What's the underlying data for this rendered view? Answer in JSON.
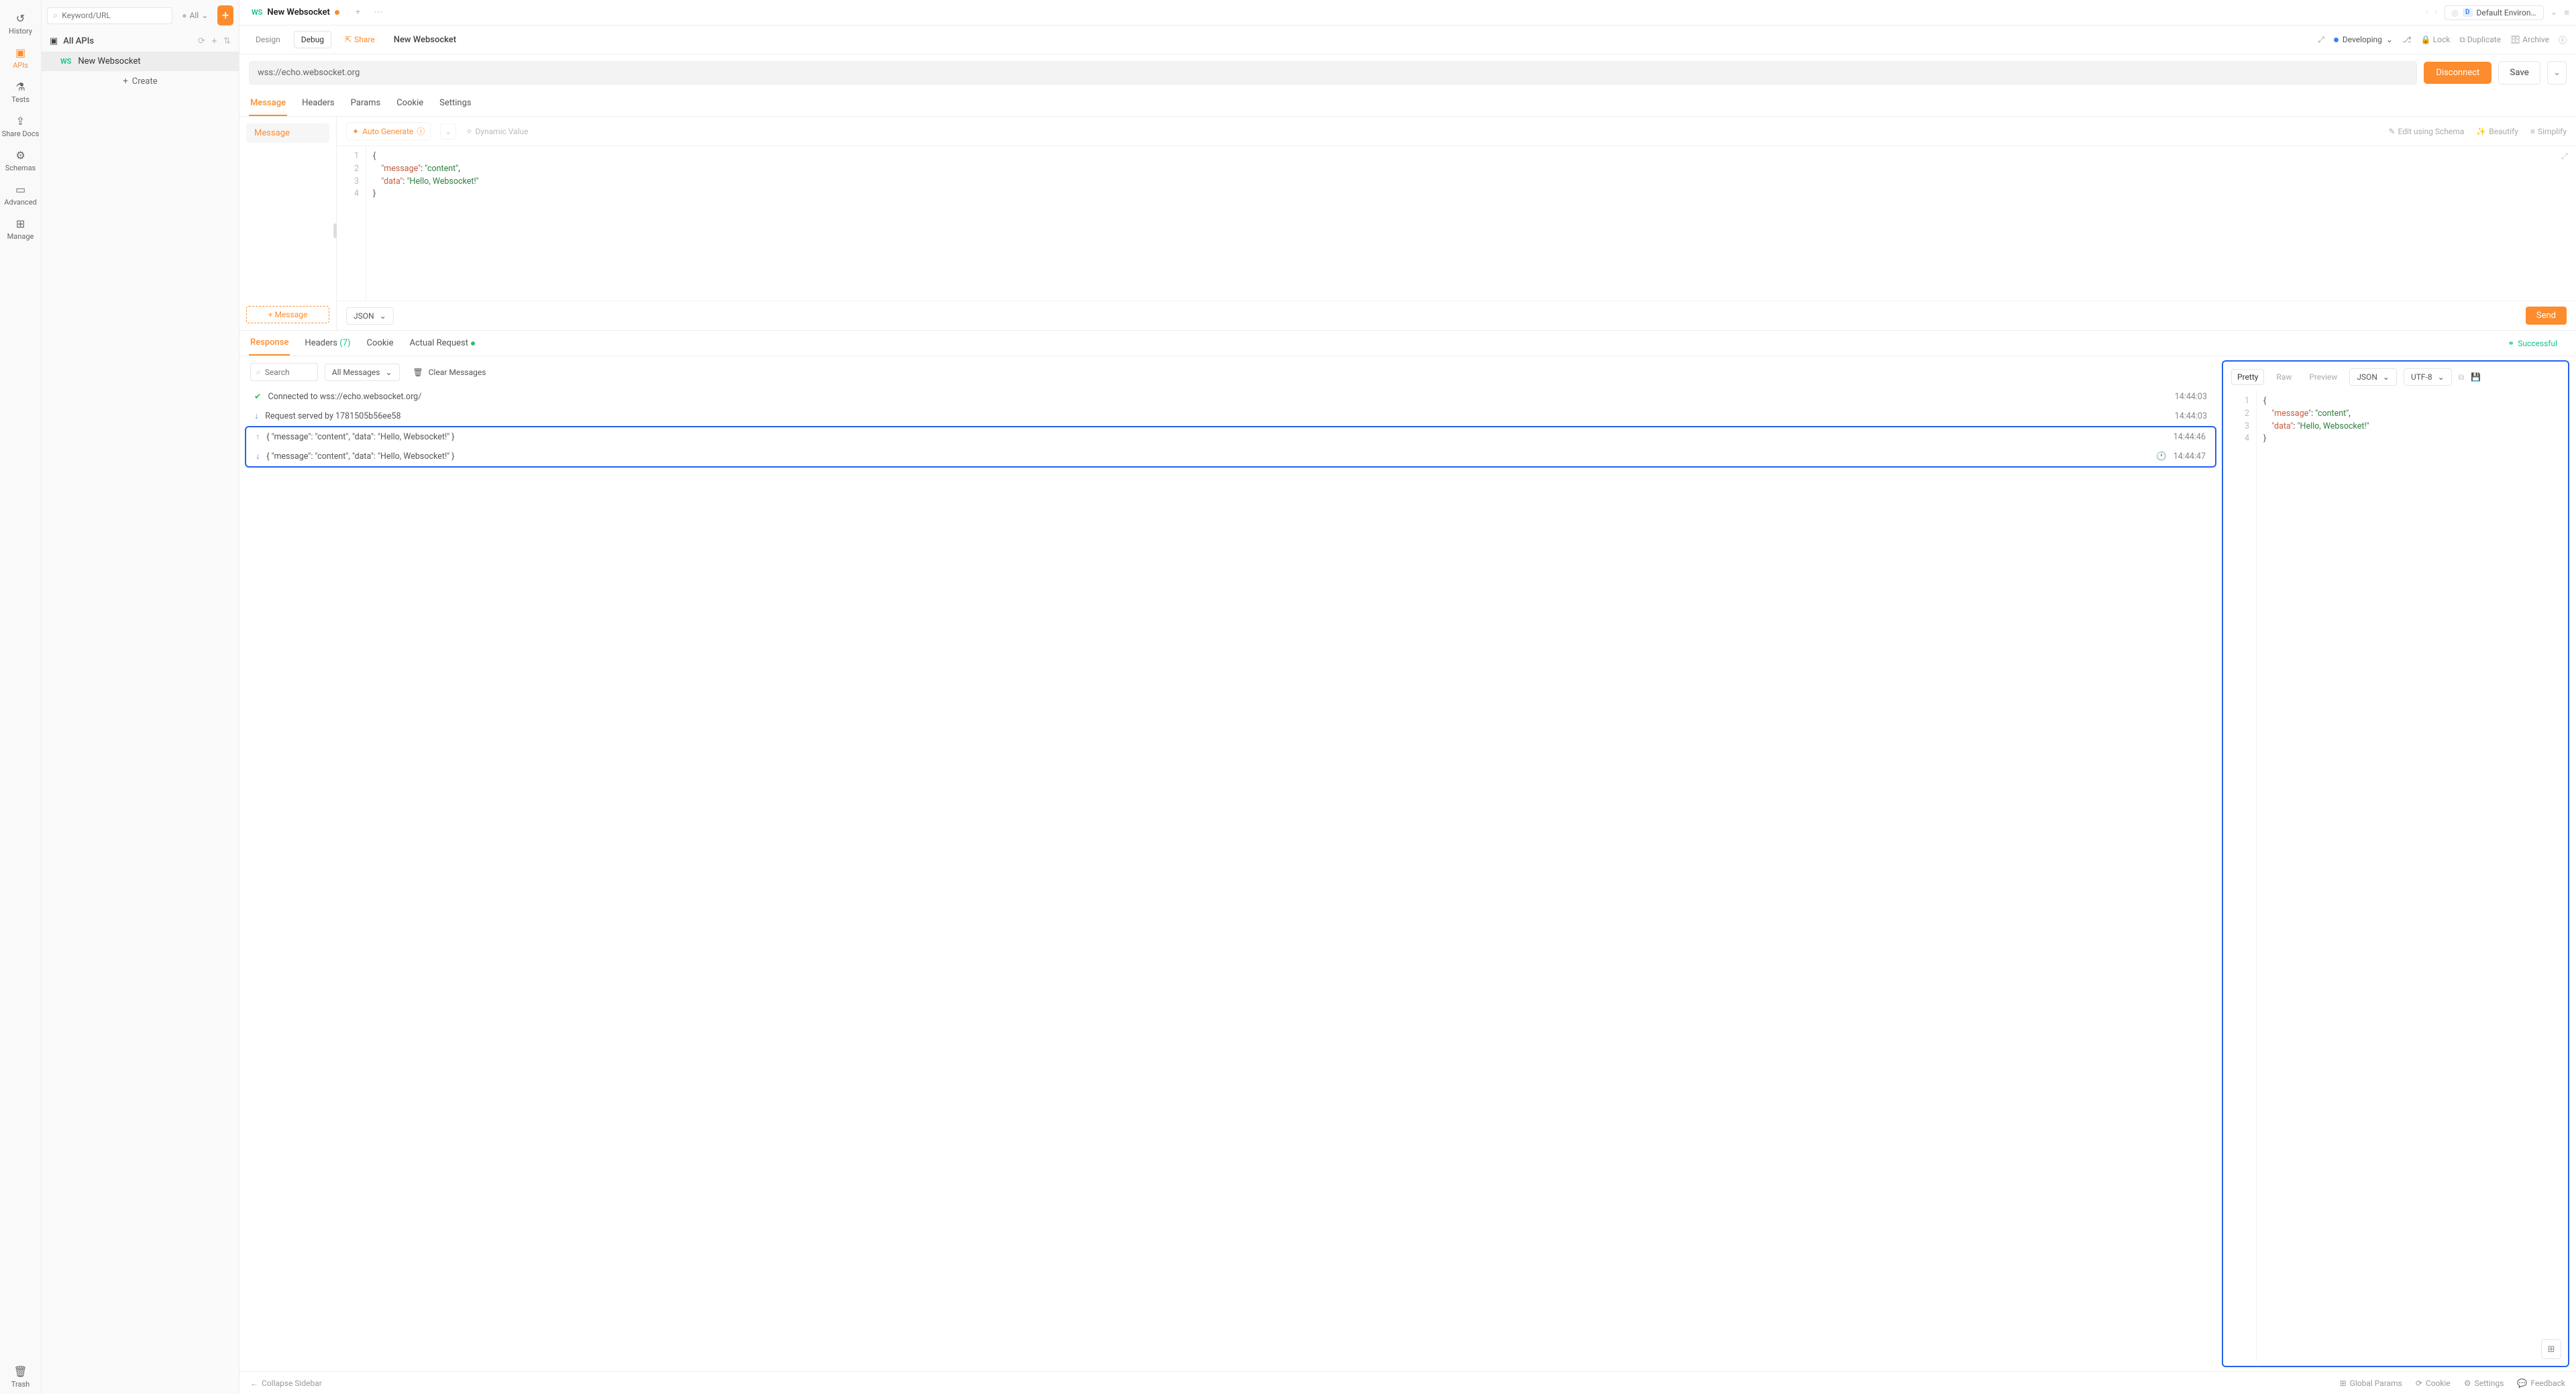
{
  "nav": {
    "history": "History",
    "apis": "APIs",
    "tests": "Tests",
    "share_docs": "Share Docs",
    "schemas": "Schemas",
    "advanced": "Advanced",
    "manage": "Manage",
    "trash": "Trash"
  },
  "sidebar": {
    "search_placeholder": "Keyword/URL",
    "filter_label": "All",
    "all_apis": "All APIs",
    "create": "Create",
    "item": {
      "badge": "WS",
      "name": "New Websocket"
    }
  },
  "tabbar": {
    "badge": "WS",
    "title": "New Websocket",
    "env": "Default Environ…",
    "env_badge": "D"
  },
  "toolbar": {
    "design": "Design",
    "debug": "Debug",
    "share": "Share",
    "title": "New Websocket",
    "developing": "Developing",
    "lock": "Lock",
    "duplicate": "Duplicate",
    "archive": "Archive"
  },
  "url_row": {
    "url": "wss://echo.websocket.org",
    "disconnect": "Disconnect",
    "save": "Save"
  },
  "req_tabs": {
    "message": "Message",
    "headers": "Headers",
    "params": "Params",
    "cookie": "Cookie",
    "settings": "Settings"
  },
  "msg_side": {
    "message": "Message",
    "add": "Message"
  },
  "editor_tb": {
    "auto_generate": "Auto Generate",
    "dynamic_value": "Dynamic Value",
    "edit_schema": "Edit using Schema",
    "beautify": "Beautify",
    "simplify": "Simplify"
  },
  "code": {
    "l1": "{",
    "l2a": "\"message\"",
    "l2b": ": ",
    "l2c": "\"content\"",
    "l2d": ",",
    "l3a": "\"data\"",
    "l3b": ": ",
    "l3c": "\"Hello, Websocket!\"",
    "l4": "}"
  },
  "editor_footer": {
    "format": "JSON",
    "send": "Send"
  },
  "resp_tabs": {
    "response": "Response",
    "headers": "Headers",
    "headers_count": "(7)",
    "cookie": "Cookie",
    "actual_request": "Actual Request",
    "successful": "Successful"
  },
  "log_tb": {
    "search_placeholder": "Search",
    "all_messages": "All Messages",
    "clear": "Clear Messages"
  },
  "log": [
    {
      "kind": "ok",
      "text": "Connected to wss://echo.websocket.org/",
      "ts": "14:44:03"
    },
    {
      "kind": "in",
      "text": "Request served by 1781505b56ee58",
      "ts": "14:44:03"
    },
    {
      "kind": "out",
      "text": "{ \"message\": \"content\", \"data\": \"Hello, Websocket!\" }",
      "ts": "14:44:46"
    },
    {
      "kind": "in",
      "text": "{ \"message\": \"content\", \"data\": \"Hello, Websocket!\" }",
      "ts": "14:44:47",
      "clock": true
    }
  ],
  "viewer": {
    "pretty": "Pretty",
    "raw": "Raw",
    "preview": "Preview",
    "format": "JSON",
    "encoding": "UTF-8"
  },
  "footer": {
    "collapse": "Collapse Sidebar",
    "global_params": "Global Params",
    "cookie": "Cookie",
    "settings": "Settings",
    "feedback": "Feedback"
  }
}
